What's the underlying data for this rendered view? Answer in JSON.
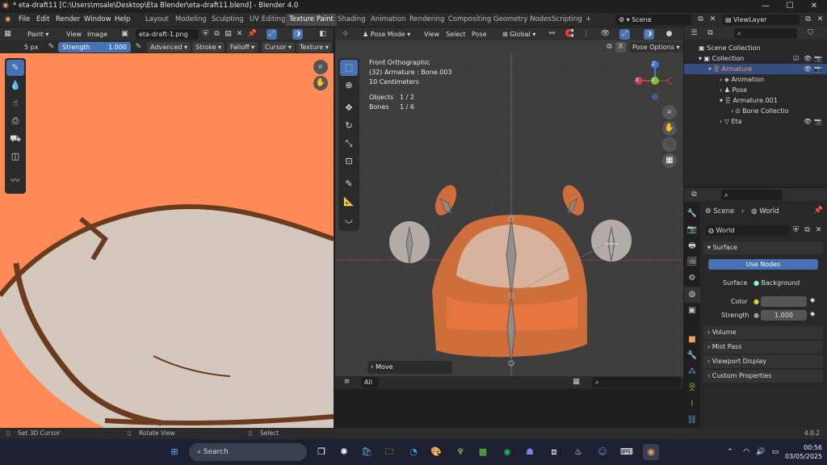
{
  "window": {
    "title": "* eta-draft11 [C:\\Users\\msale\\Desktop\\Eta Blender\\eta-draft11.blend] - Blender 4.0",
    "minimize": "—",
    "maximize": "☐",
    "close": "✕"
  },
  "menus": [
    "File",
    "Edit",
    "Render",
    "Window",
    "Help"
  ],
  "workspaces": [
    "Layout",
    "Modeling",
    "Sculpting",
    "UV Editing",
    "Texture Paint",
    "Shading",
    "Animation",
    "Rendering",
    "Compositing",
    "Geometry Nodes",
    "Scripting"
  ],
  "active_workspace": "Texture Paint",
  "add_workspace": "+",
  "scene": {
    "name": "Scene",
    "view_layer": "ViewLayer"
  },
  "image_editor": {
    "mode": "Paint",
    "view": "View",
    "image_menu": "Image",
    "image_name": "eta-draft-1.png",
    "radius": "5 px",
    "strength_label": "Strength",
    "strength_value": "1.000",
    "advanced": "Advanced",
    "stroke": "Stroke",
    "falloff": "Falloff",
    "cursor": "Cursor",
    "texture": "Texture"
  },
  "viewport": {
    "mode": "Pose Mode",
    "view": "View",
    "select": "Select",
    "pose": "Pose",
    "orientation": "Global",
    "pose_options": "Pose Options",
    "view_name": "Front Orthographic",
    "active": "(32) Armature : Bone.003",
    "scale": "10 Centimeters",
    "objects_label": "Objects",
    "objects_value": "1 / 2",
    "bones_label": "Bones",
    "bones_value": "1 / 6",
    "last_op": "Move",
    "all_btn": "All",
    "axis_x": "X",
    "axis_y": "Y",
    "axis_z": "Z"
  },
  "outliner": {
    "items": [
      {
        "label": "Scene Collection"
      },
      {
        "label": "Collection"
      },
      {
        "label": "Armature"
      },
      {
        "label": "Animation"
      },
      {
        "label": "Pose"
      },
      {
        "label": "Armature.001"
      },
      {
        "label": "Bone Collectio"
      },
      {
        "label": "Eta"
      }
    ]
  },
  "properties": {
    "breadcrumb_scene": "Scene",
    "breadcrumb_world": "World",
    "world_name": "World",
    "surface_panel": "Surface",
    "use_nodes": "Use Nodes",
    "surface_label": "Surface",
    "surface_value": "Background",
    "color_label": "Color",
    "strength_label": "Strength",
    "strength_value": "1.000",
    "panels": [
      "Volume",
      "Mist Pass",
      "Viewport Display",
      "Custom Properties"
    ]
  },
  "status": {
    "left": "Set 3D Cursor",
    "middle": "Rotate View",
    "right": "Select",
    "version": "4.0.2"
  },
  "taskbar": {
    "search": "Search",
    "time": "00:56",
    "date": "03/05/2025"
  },
  "colors": {
    "accent": "#4772b3",
    "orange_bg": "#ff8a55",
    "selected_row": "#334d80"
  }
}
